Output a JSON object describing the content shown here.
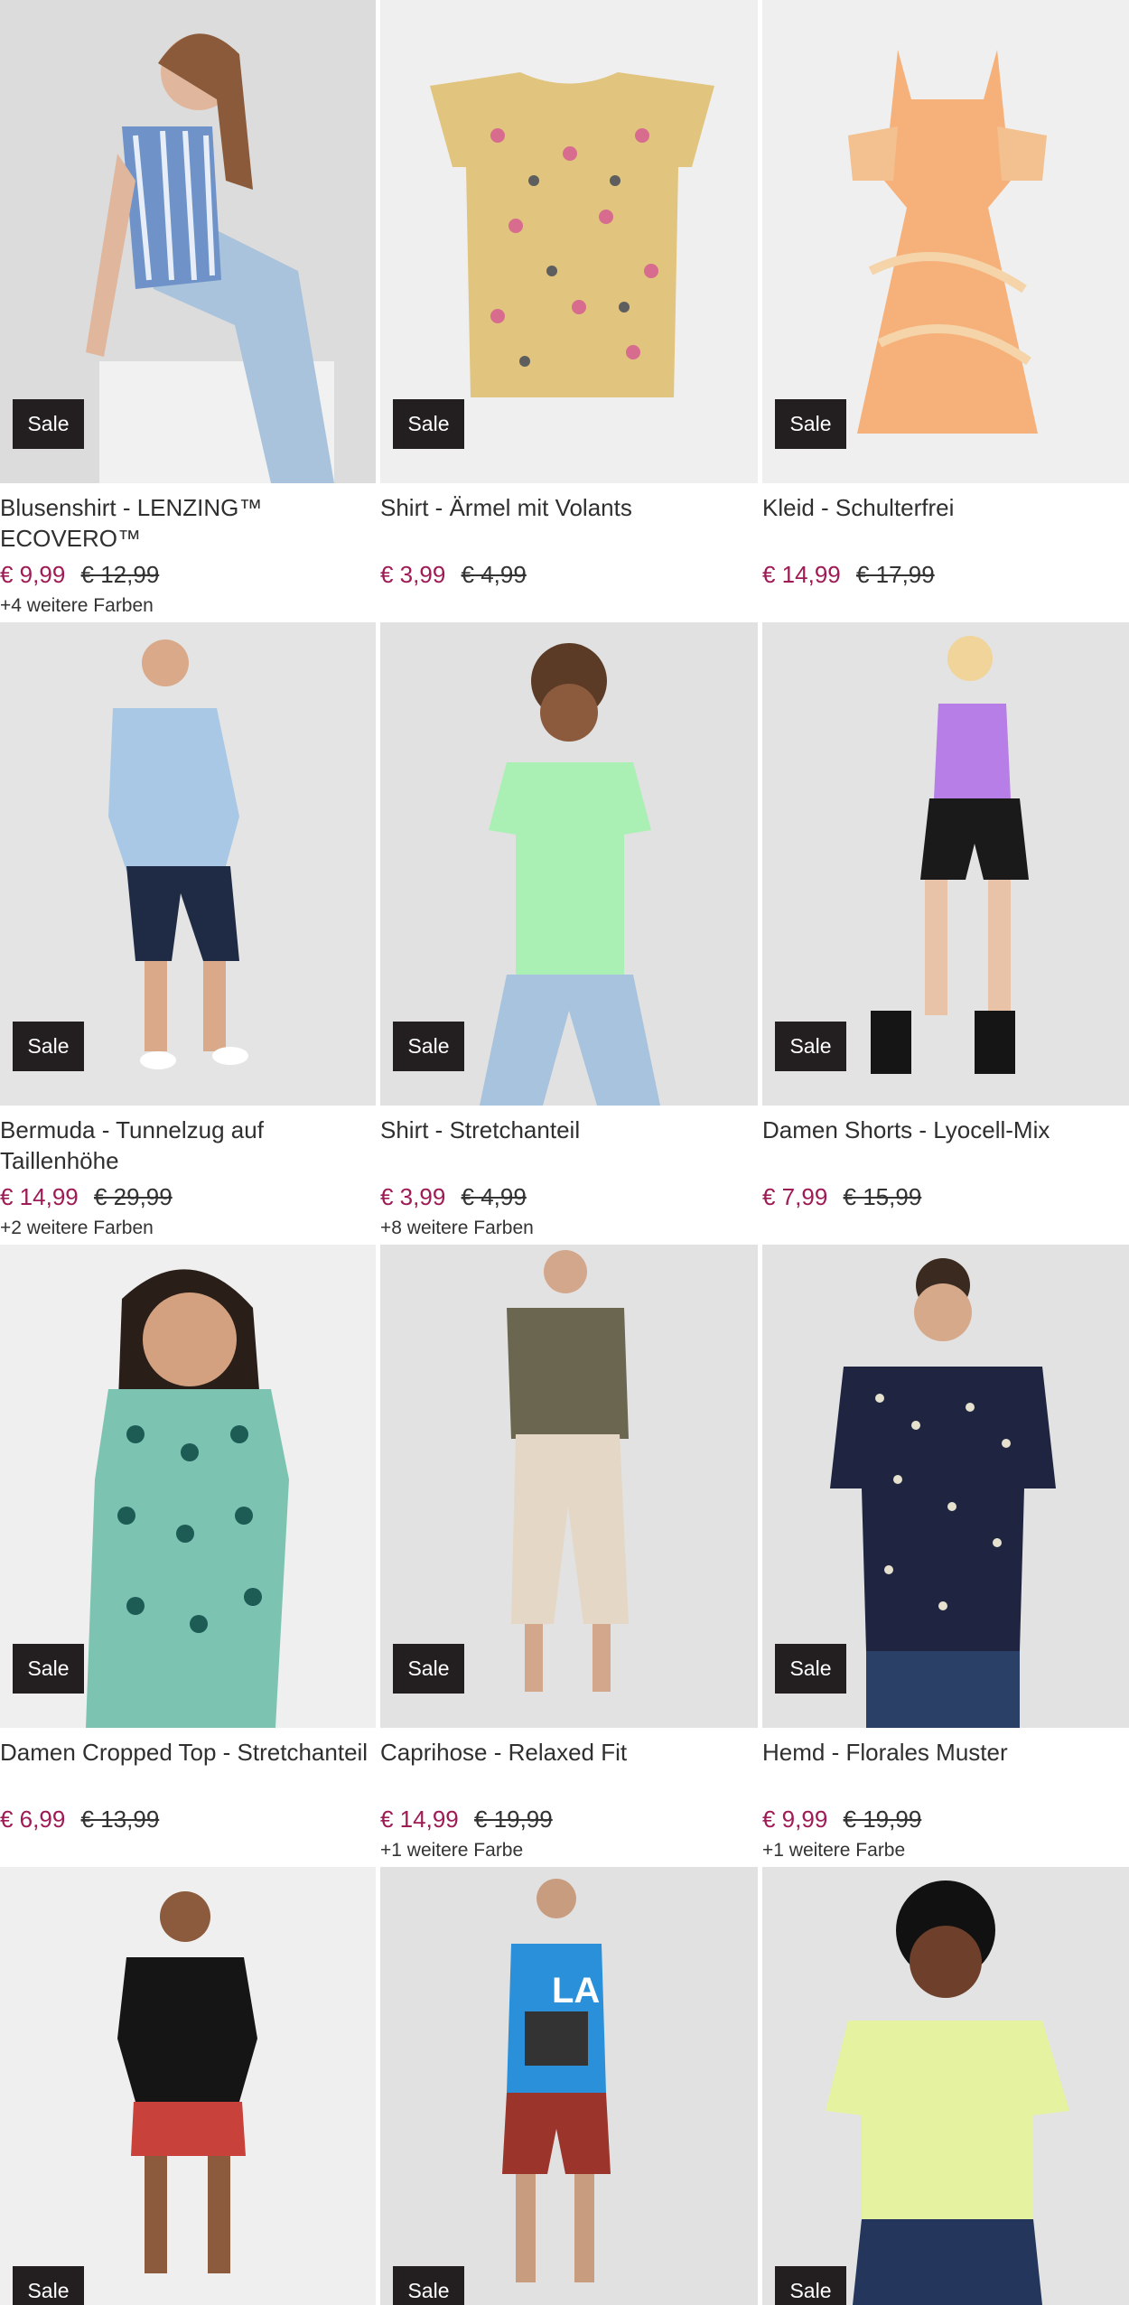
{
  "colors": {
    "sale_badge_bg": "#231f20",
    "sale_price": "#9e1b55",
    "old_price": "#333333",
    "text": "#2f2f2f"
  },
  "products": [
    {
      "name": "Blusenshirt - LENZING™ ECOVERO™",
      "badge": "Sale",
      "price": "€ 9,99",
      "old_price": "€ 12,99",
      "colors_note": "+4 weitere Farben",
      "image": "woman-striped-blouse-photo"
    },
    {
      "name": "Shirt - Ärmel mit Volants",
      "badge": "Sale",
      "price": "€ 3,99",
      "old_price": "€ 4,99",
      "colors_note": "",
      "image": "beige-printed-kids-shirt-photo"
    },
    {
      "name": "Kleid - Schulterfrei",
      "badge": "Sale",
      "price": "€ 14,99",
      "old_price": "€ 17,99",
      "colors_note": "",
      "image": "orange-tie-dye-dress-photo"
    },
    {
      "name": "Bermuda - Tunnelzug auf Taillenhöhe",
      "badge": "Sale",
      "price": "€ 14,99",
      "old_price": "€ 29,99",
      "colors_note": "+2 weitere Farben",
      "image": "man-bermuda-shorts-photo"
    },
    {
      "name": "Shirt - Stretchanteil",
      "badge": "Sale",
      "price": "€ 3,99",
      "old_price": "€ 4,99",
      "colors_note": "+8 weitere Farben",
      "image": "woman-mint-shirt-photo"
    },
    {
      "name": "Damen Shorts - Lyocell-Mix",
      "badge": "Sale",
      "price": "€ 7,99",
      "old_price": "€ 15,99",
      "colors_note": "",
      "image": "woman-black-shorts-photo"
    },
    {
      "name": "Damen Cropped Top - Stretchanteil",
      "badge": "Sale",
      "price": "€ 6,99",
      "old_price": "€ 13,99",
      "colors_note": "",
      "image": "woman-green-pattern-top-photo"
    },
    {
      "name": "Caprihose - Relaxed Fit",
      "badge": "Sale",
      "price": "€ 14,99",
      "old_price": "€ 19,99",
      "colors_note": "+1 weitere Farbe",
      "image": "woman-beige-capri-photo"
    },
    {
      "name": "Hemd - Florales Muster",
      "badge": "Sale",
      "price": "€ 9,99",
      "old_price": "€ 19,99",
      "colors_note": "+1 weitere Farbe",
      "image": "man-floral-shirt-photo"
    },
    {
      "name": "",
      "badge": "Sale",
      "price": "",
      "old_price": "",
      "colors_note": "",
      "image": "woman-black-top-red-shorts-photo"
    },
    {
      "name": "",
      "badge": "Sale",
      "price": "",
      "old_price": "",
      "colors_note": "",
      "image": "man-blue-tank-top-photo"
    },
    {
      "name": "",
      "badge": "Sale",
      "price": "",
      "old_price": "",
      "colors_note": "",
      "image": "woman-lime-shirt-photo"
    }
  ]
}
